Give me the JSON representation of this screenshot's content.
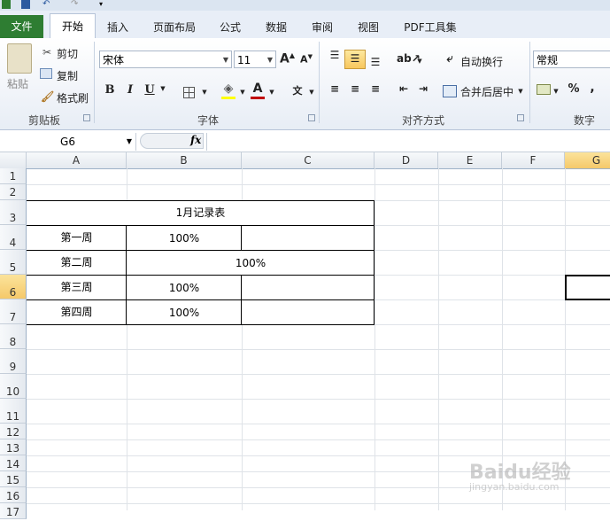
{
  "ribbon_tabs": [
    {
      "label": "文件"
    },
    {
      "label": "开始"
    },
    {
      "label": "插入"
    },
    {
      "label": "页面布局"
    },
    {
      "label": "公式"
    },
    {
      "label": "数据"
    },
    {
      "label": "审阅"
    },
    {
      "label": "视图"
    },
    {
      "label": "PDF工具集"
    }
  ],
  "clipboard": {
    "paste": "粘贴",
    "cut": "剪切",
    "copy": "复制",
    "format_painter": "格式刷",
    "group": "剪贴板"
  },
  "font": {
    "name": "宋体",
    "size": "11",
    "bold": "B",
    "italic": "I",
    "underline": "U",
    "group": "字体",
    "font_color": "#c00000",
    "fill_color": "#ffff00"
  },
  "alignment": {
    "wrap": "自动换行",
    "merge": "合并后居中",
    "group": "对齐方式"
  },
  "number": {
    "format": "常规",
    "percent": "%",
    "comma": ",",
    "group": "数字"
  },
  "formula_bar": {
    "name_box": "G6",
    "fx": "fx",
    "content": ""
  },
  "columns": [
    "A",
    "B",
    "C",
    "D",
    "E",
    "F",
    "G"
  ],
  "rows": [
    "1",
    "2",
    "3",
    "4",
    "5",
    "6",
    "7",
    "8",
    "9",
    "10",
    "11",
    "12",
    "13",
    "14",
    "15",
    "16",
    "17"
  ],
  "selected": {
    "column": "G",
    "row": "6"
  },
  "table": {
    "title": "1月记录表",
    "rows": [
      {
        "label": "第一周",
        "value": "100%"
      },
      {
        "label": "第二周",
        "value": "100%"
      },
      {
        "label": "第三周",
        "value": "100%"
      },
      {
        "label": "第四周",
        "value": "100%"
      }
    ]
  },
  "watermark": {
    "main": "Baidu经验",
    "sub": "jingyan.baidu.com"
  }
}
